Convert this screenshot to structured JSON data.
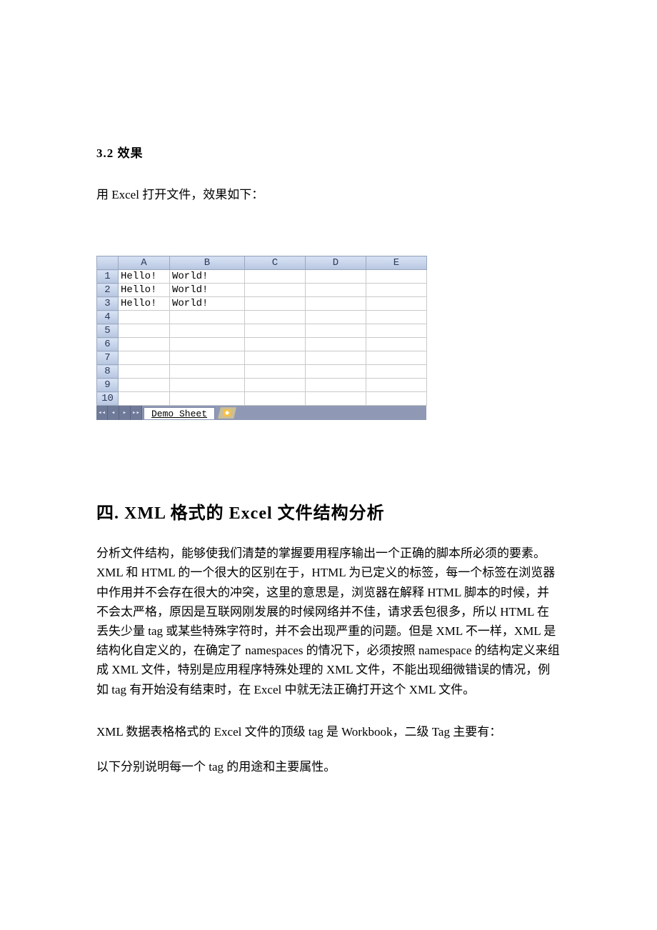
{
  "section32": {
    "heading": "3.2 效果",
    "intro": "用 Excel 打开文件，效果如下："
  },
  "excel": {
    "columns": [
      "A",
      "B",
      "C",
      "D",
      "E"
    ],
    "rows": [
      {
        "n": "1",
        "cells": [
          "Hello!",
          "World!",
          "",
          "",
          ""
        ]
      },
      {
        "n": "2",
        "cells": [
          "Hello!",
          "World!",
          "",
          "",
          ""
        ]
      },
      {
        "n": "3",
        "cells": [
          "Hello!",
          "World!",
          "",
          "",
          ""
        ]
      },
      {
        "n": "4",
        "cells": [
          "",
          "",
          "",
          "",
          ""
        ]
      },
      {
        "n": "5",
        "cells": [
          "",
          "",
          "",
          "",
          ""
        ]
      },
      {
        "n": "6",
        "cells": [
          "",
          "",
          "",
          "",
          ""
        ]
      },
      {
        "n": "7",
        "cells": [
          "",
          "",
          "",
          "",
          ""
        ]
      },
      {
        "n": "8",
        "cells": [
          "",
          "",
          "",
          "",
          ""
        ]
      },
      {
        "n": "9",
        "cells": [
          "",
          "",
          "",
          "",
          ""
        ]
      },
      {
        "n": "10",
        "cells": [
          "",
          "",
          "",
          "",
          ""
        ]
      }
    ],
    "sheet_name": "Demo Sheet",
    "nav": {
      "first": "◂◂",
      "prev": "◂",
      "next": "▸",
      "last": "▸▸"
    }
  },
  "section4": {
    "heading": "四. XML 格式的 Excel 文件结构分析",
    "p1": "分析文件结构，能够使我们清楚的掌握要用程序输出一个正确的脚本所必须的要素。XML 和 HTML 的一个很大的区别在于，HTML 为已定义的标签，每一个标签在浏览器中作用并不会存在很大的冲突，这里的意思是，浏览器在解释 HTML 脚本的时候，并不会太严格，原因是互联网刚发展的时候网络并不佳，请求丢包很多，所以 HTML 在丢失少量 tag 或某些特殊字符时，并不会出现严重的问题。但是 XML 不一样，XML 是结构化自定义的，在确定了 namespaces 的情况下，必须按照 namespace 的结构定义来组成 XML 文件，特别是应用程序特殊处理的 XML 文件，不能出现细微错误的情况，例如 tag 有开始没有结束时，在 Excel 中就无法正确打开这个 XML 文件。",
    "p2": "XML 数据表格格式的 Excel 文件的顶级 tag 是 Workbook，二级 Tag 主要有：",
    "p3": "以下分别说明每一个 tag 的用途和主要属性。"
  }
}
